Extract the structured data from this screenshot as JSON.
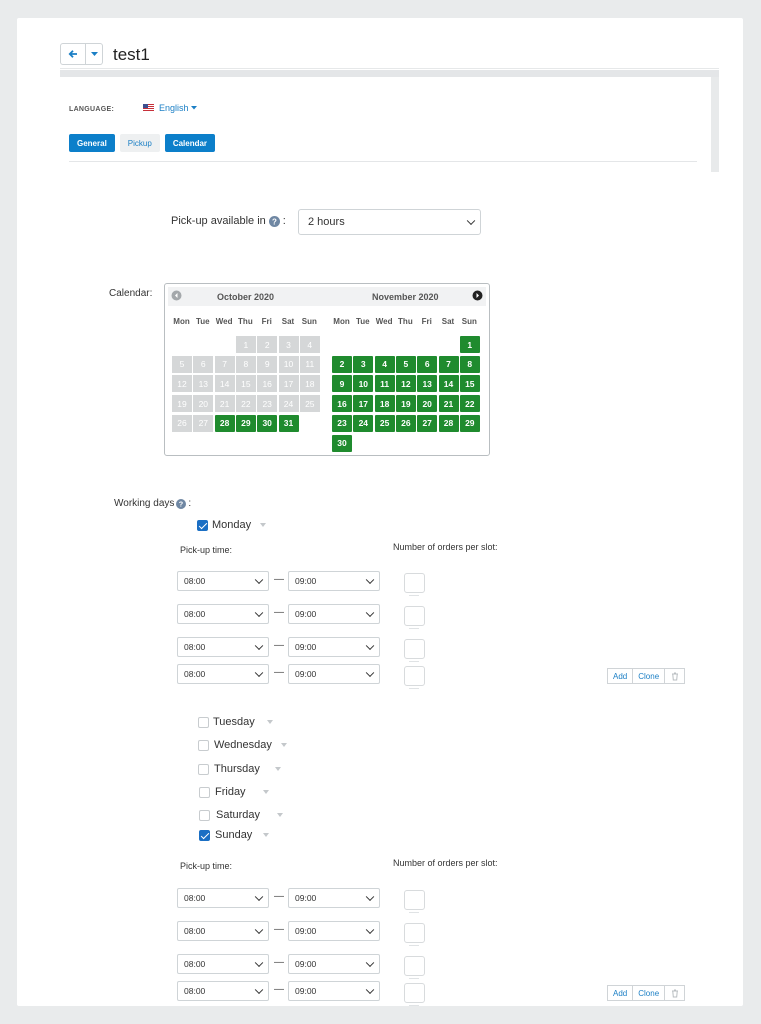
{
  "header": {
    "title": "test1"
  },
  "language": {
    "label": "LANGUAGE:",
    "value": "English",
    "flag_icon": "us-flag-icon"
  },
  "tabs": [
    {
      "label": "General",
      "active": true
    },
    {
      "label": "Pickup",
      "active": false
    },
    {
      "label": "Calendar",
      "active": true
    }
  ],
  "pickup": {
    "label": "Pick-up available in",
    "value": "2 hours"
  },
  "calendar": {
    "label": "Calendar:",
    "left_month": "October 2020",
    "right_month": "November 2020",
    "weekdays": [
      "Mon",
      "Tue",
      "Wed",
      "Thu",
      "Fri",
      "Sat",
      "Sun"
    ],
    "october": {
      "first_weekday": 4,
      "days": 31,
      "available_from": 28
    },
    "november": {
      "first_weekday": 7,
      "days": 30,
      "available_from": 1
    },
    "colors": {
      "available": "#1f8b2e",
      "past": "#d5d7d8"
    }
  },
  "working_days": {
    "label": "Working days",
    "pickup_time_label": "Pick-up time:",
    "orders_label": "Number of orders per slot:",
    "add_label": "Add",
    "clone_label": "Clone",
    "days": [
      {
        "name": "Monday",
        "checked": true
      },
      {
        "name": "Tuesday",
        "checked": false
      },
      {
        "name": "Wednesday",
        "checked": false
      },
      {
        "name": "Thursday",
        "checked": false
      },
      {
        "name": "Friday",
        "checked": false
      },
      {
        "name": "Saturday",
        "checked": false
      },
      {
        "name": "Sunday",
        "checked": true
      }
    ],
    "monday_slots": [
      {
        "from": "08:00",
        "to": "09:00"
      },
      {
        "from": "08:00",
        "to": "09:00"
      },
      {
        "from": "08:00",
        "to": "09:00"
      },
      {
        "from": "08:00",
        "to": "09:00"
      }
    ],
    "sunday_slots": [
      {
        "from": "08:00",
        "to": "09:00"
      },
      {
        "from": "08:00",
        "to": "09:00"
      },
      {
        "from": "08:00",
        "to": "09:00"
      },
      {
        "from": "08:00",
        "to": "09:00"
      }
    ]
  }
}
